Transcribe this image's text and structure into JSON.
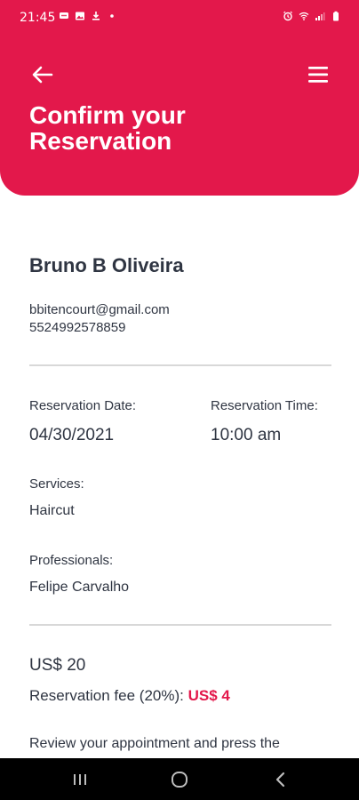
{
  "status_bar": {
    "time": "21:45"
  },
  "header": {
    "title": "Confirm your\nReservation",
    "accent_color": "#e3184b"
  },
  "customer": {
    "name": "Bruno B Oliveira",
    "email": "bbitencourt@gmail.com",
    "phone": "5524992578859"
  },
  "reservation": {
    "date_label": "Reservation Date:",
    "date_value": "04/30/2021",
    "time_label": "Reservation Time:",
    "time_value": "10:00 am",
    "services_label": "Services:",
    "services_value": "Haircut",
    "professionals_label": "Professionals:",
    "professionals_value": "Felipe Carvalho"
  },
  "pricing": {
    "total": "US$ 20",
    "fee_label": "Reservation fee (20%):",
    "fee_amount": "US$ 4"
  },
  "review_text": "Review your appointment and press the",
  "icons": {
    "back": "arrow-left-icon",
    "menu": "hamburger-menu-icon",
    "nav_recent": "recent-apps-icon",
    "nav_home": "home-icon",
    "nav_back": "chevron-left-icon"
  }
}
